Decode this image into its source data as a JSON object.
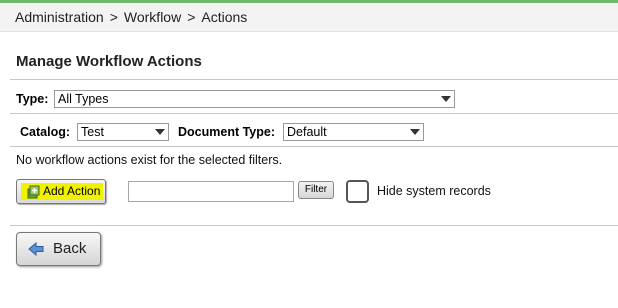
{
  "breadcrumb": {
    "items": [
      "Administration",
      "Workflow",
      "Actions"
    ],
    "separator": ">"
  },
  "page": {
    "title": "Manage Workflow Actions"
  },
  "filters": {
    "type_label": "Type:",
    "type_value": "All Types",
    "catalog_label": "Catalog:",
    "catalog_value": "Test",
    "document_type_label": "Document Type:",
    "document_type_value": "Default"
  },
  "message": "No workflow actions exist for the selected filters.",
  "toolbar": {
    "add_action_label": "Add Action",
    "filter_input_value": "",
    "filter_button_label": "Filter",
    "hide_system_records_label": "Hide system records",
    "hide_system_records_checked": false
  },
  "footer": {
    "back_label": "Back"
  },
  "colors": {
    "accent_green": "#6eb96b",
    "highlight_yellow": "#f2f200",
    "back_icon_blue": "#5b8fd6"
  }
}
